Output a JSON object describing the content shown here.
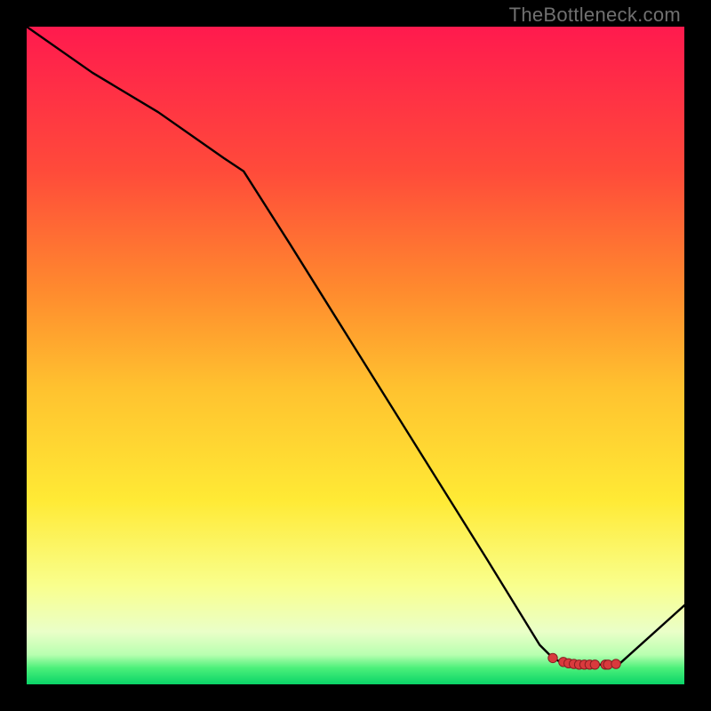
{
  "watermark": "TheBottleneck.com",
  "chart_data": {
    "type": "line",
    "title": "",
    "xlabel": "",
    "ylabel": "",
    "xlim": [
      0,
      100
    ],
    "ylim": [
      0,
      100
    ],
    "x": [
      0,
      10,
      20,
      30,
      33,
      40,
      50,
      60,
      70,
      78,
      80,
      82,
      84,
      86,
      88,
      89,
      90,
      100
    ],
    "values": [
      100,
      93,
      87,
      80,
      78,
      67,
      51,
      35,
      19,
      6,
      4,
      3,
      3,
      3,
      3,
      3,
      3,
      12
    ],
    "markers_x": [
      80.0,
      81.6,
      82.4,
      83.2,
      84.0,
      84.8,
      85.6,
      86.4,
      88.0,
      88.4,
      89.6
    ],
    "markers_y": [
      4.0,
      3.4,
      3.2,
      3.1,
      3.0,
      3.0,
      3.0,
      3.0,
      3.0,
      3.0,
      3.1
    ],
    "gradient_stops": [
      {
        "offset": 0.0,
        "color": "#ff1a4e"
      },
      {
        "offset": 0.22,
        "color": "#ff4b3a"
      },
      {
        "offset": 0.4,
        "color": "#ff8a2e"
      },
      {
        "offset": 0.55,
        "color": "#ffc22f"
      },
      {
        "offset": 0.72,
        "color": "#ffea35"
      },
      {
        "offset": 0.85,
        "color": "#f9ff8d"
      },
      {
        "offset": 0.92,
        "color": "#eaffc8"
      },
      {
        "offset": 0.955,
        "color": "#b8ffb0"
      },
      {
        "offset": 0.975,
        "color": "#4cf07a"
      },
      {
        "offset": 1.0,
        "color": "#0ad468"
      }
    ],
    "line_color": "#000000",
    "marker_fill": "#d93a3d",
    "marker_stroke": "#8a1f22"
  }
}
